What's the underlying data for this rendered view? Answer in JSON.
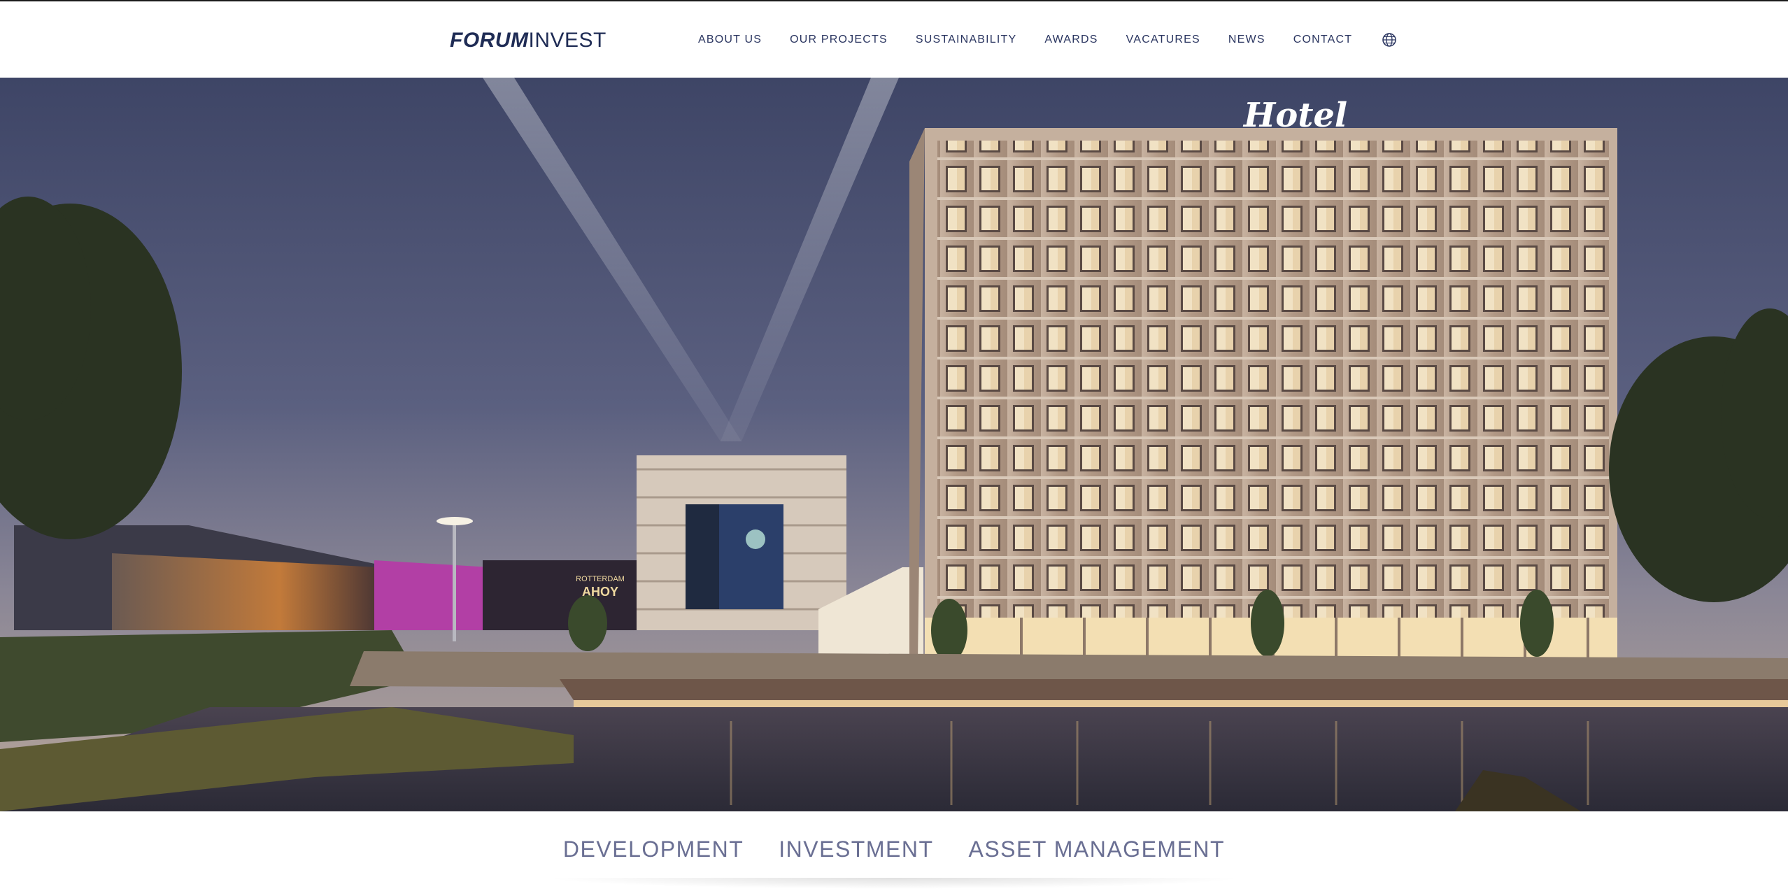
{
  "brand": {
    "logo_bold": "FORUM",
    "logo_light": "INVEST"
  },
  "nav": {
    "items": [
      "ABOUT US",
      "OUR PROJECTS",
      "SUSTAINABILITY",
      "AWARDS",
      "VACATURES",
      "NEWS",
      "CONTACT"
    ],
    "language_icon": "globe-icon"
  },
  "hero": {
    "hotel_sign": "Hotel",
    "arena_sign_small": "ROTTERDAM",
    "arena_sign": "AHOY"
  },
  "services": [
    "DEVELOPMENT",
    "INVESTMENT",
    "ASSET MANAGEMENT"
  ],
  "colors": {
    "brand_navy": "#1f2c55",
    "nav_text": "#2a3560",
    "services_text": "#6a6f93"
  }
}
